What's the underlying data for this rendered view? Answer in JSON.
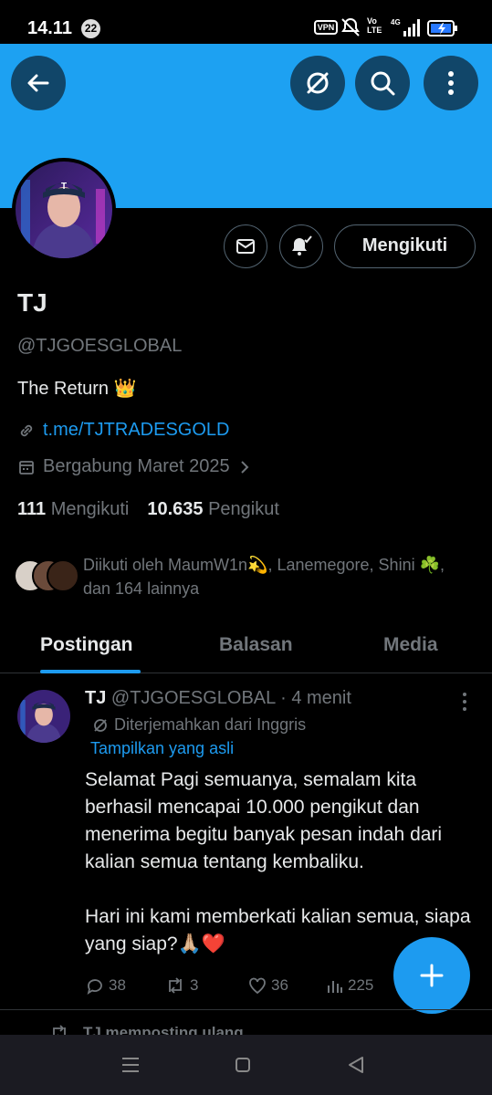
{
  "status_bar": {
    "time": "14.11",
    "notification_count": "22",
    "vpn_label": "VPN",
    "volte_label": "Vo LTE",
    "network_label": "4G"
  },
  "header": {
    "icons": [
      "back-arrow-icon",
      "translate-icon",
      "search-icon",
      "more-vertical-icon"
    ],
    "banner_color": "#1da1f2"
  },
  "profile": {
    "follow_button": "Mengikuti",
    "name": "TJ",
    "handle": "@TJGOESGLOBAL",
    "bio": "The Return 👑",
    "link": "t.me/TJTRADESGOLD",
    "joined": "Bergabung Maret 2025",
    "following_count": "111",
    "following_label": "Mengikuti",
    "followers_count": "10.635",
    "followers_label": "Pengikut",
    "followed_by": "Diikuti oleh MaumW1n💫, Lanemegore, Shini ☘️, dan 164 lainnya"
  },
  "tabs": [
    {
      "label": "Postingan",
      "active": true
    },
    {
      "label": "Balasan",
      "active": false
    },
    {
      "label": "Media",
      "active": false
    }
  ],
  "post": {
    "name": "TJ",
    "handle": "@TJGOESGLOBAL",
    "separator": "·",
    "time": "4 menit",
    "translated_label": "Diterjemahkan dari Inggris",
    "show_original": "Tampilkan yang asli",
    "body": "Selamat Pagi semuanya, semalam kita berhasil mencapai 10.000 pengikut dan menerima begitu banyak pesan indah dari kalian semua tentang kembaliku.\n\nHari ini kami memberkati kalian semua, siapa yang siap?🙏🏼❤️",
    "replies": "38",
    "reposts": "3",
    "likes": "36",
    "views": "225"
  },
  "next_post": {
    "repost_label": "TJ memposting ulang"
  },
  "colors": {
    "accent": "#1d9bf0",
    "muted": "#71767b",
    "text": "#e7e9ea",
    "background": "#000000"
  }
}
